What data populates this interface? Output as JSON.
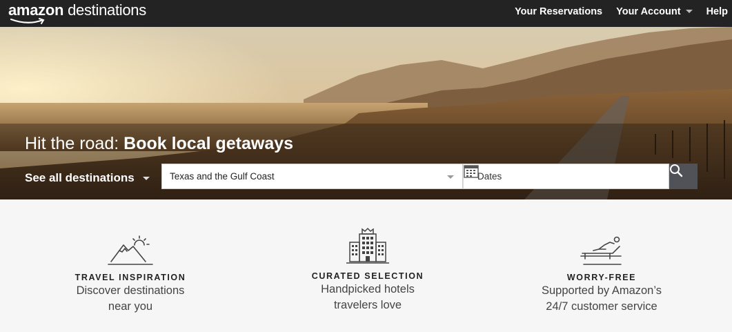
{
  "nav": {
    "logo_brand": "amazon",
    "logo_product": "destinations",
    "links": [
      "Your Reservations",
      "Your Account",
      "Help"
    ]
  },
  "hero": {
    "title_prefix": "Hit the road:",
    "title_bold": "Book local getaways",
    "see_all_label": "See all destinations",
    "destination_value": "Texas and the Gulf Coast",
    "dates_placeholder": "Dates"
  },
  "features": [
    {
      "icon": "mountain-sun-icon",
      "title": "TRAVEL INSPIRATION",
      "line1": "Discover destinations",
      "line2": "near you"
    },
    {
      "icon": "hotel-building-icon",
      "title": "CURATED SELECTION",
      "line1": "Handpicked hotels",
      "line2": "travelers love"
    },
    {
      "icon": "lounge-chair-icon",
      "title": "WORRY-FREE",
      "line1": "Supported by Amazon’s",
      "line2": "24/7 customer service"
    }
  ],
  "colors": {
    "nav_bg": "#232323",
    "search_btn": "#505257",
    "page_bg": "#f6f6f6"
  }
}
